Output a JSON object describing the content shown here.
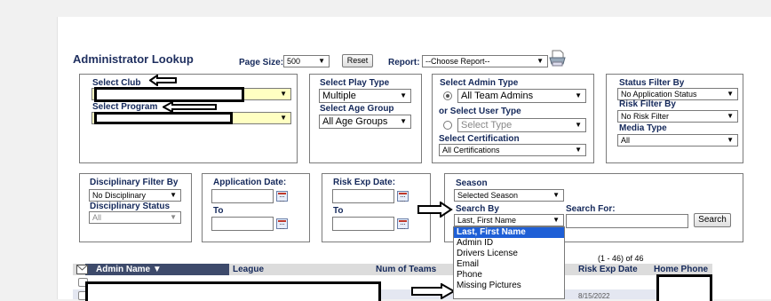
{
  "title": "Administrator Lookup",
  "page_size": {
    "label": "Page Size:",
    "value": "500"
  },
  "reset_label": "Reset",
  "report": {
    "label": "Report:",
    "value": "--Choose Report--"
  },
  "club": {
    "label": "Select Club"
  },
  "program": {
    "label": "Select Program"
  },
  "play_type": {
    "label": "Select Play Type",
    "value": "Multiple"
  },
  "age_group": {
    "label": "Select Age Group",
    "value": "All Age Groups"
  },
  "admin_type": {
    "label": "Select Admin Type",
    "value": "All Team Admins",
    "or_label": "or Select User Type",
    "user_type_value": "Select Type"
  },
  "certification": {
    "label": "Select Certification",
    "value": "All Certifications"
  },
  "status_filter": {
    "label": "Status Filter By",
    "value": "No Application Status"
  },
  "risk_filter": {
    "label": "Risk Filter By",
    "value": "No Risk Filter"
  },
  "media_type": {
    "label": "Media Type",
    "value": "All"
  },
  "disciplinary_filter": {
    "label": "Disciplinary Filter By",
    "value": "No Disciplinary"
  },
  "disciplinary_status": {
    "label": "Disciplinary Status",
    "value": "All"
  },
  "application_date": {
    "label": "Application Date:",
    "to": "To"
  },
  "risk_exp_date": {
    "label": "Risk Exp Date:",
    "to": "To"
  },
  "season": {
    "label": "Season",
    "value": "Selected Season"
  },
  "search_by": {
    "label": "Search By",
    "value": "Last, First Name"
  },
  "search_for": {
    "label": "Search For:"
  },
  "search_button": "Search",
  "dropdown_options": [
    "Last, First Name",
    "Admin ID",
    "Drivers License",
    "Email",
    "Phone",
    "Missing Pictures"
  ],
  "results_count": "(1 - 46) of 46",
  "columns": {
    "admin_name": "Admin Name",
    "league": "League",
    "num_teams": "Num of Teams",
    "risk_exp": "Risk Exp Date",
    "home_phone": "Home Phone"
  },
  "row_partial_date": "8/15/2022",
  "colors": {
    "label_navy": "#14285a",
    "highlight": "#1e5fd6",
    "field_yellow": "#ffffc2",
    "header_dark": "#3d4a6b"
  }
}
